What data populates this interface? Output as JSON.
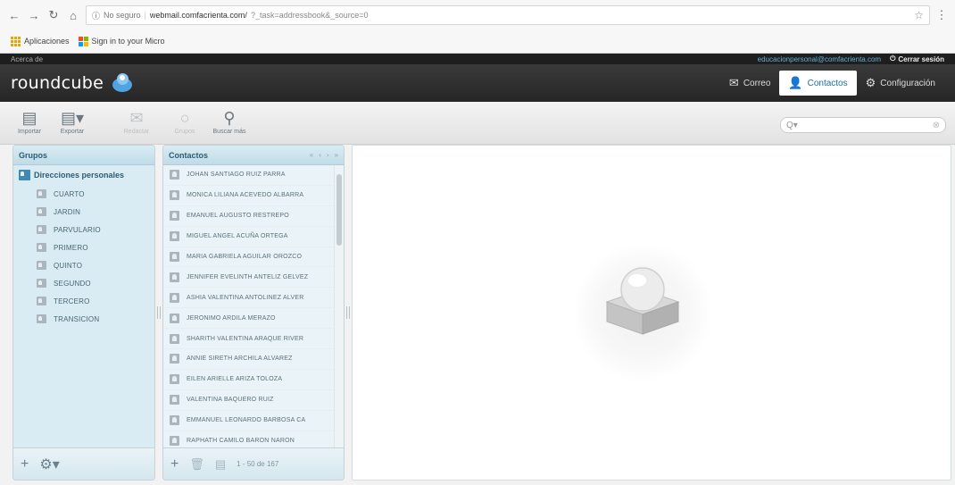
{
  "browser": {
    "secure_label": "No seguro",
    "url_host": "webmail.comfacrienta.com/",
    "url_rest": "?_task=addressbook&_source=0",
    "bookmarks": [
      "Aplicaciones",
      "Sign in to your Micro"
    ]
  },
  "topline": {
    "left": "Acerca de",
    "user": "educacionpersonal@comfacrienta.com",
    "logout": "Cerrar sesión"
  },
  "header": {
    "logo": "roundcube",
    "tasks": [
      {
        "label": "Correo",
        "icon": "mail-icon"
      },
      {
        "label": "Contactos",
        "icon": "contacts-icon"
      },
      {
        "label": "Configuración",
        "icon": "gear-icon"
      }
    ]
  },
  "toolbar": {
    "buttons": [
      {
        "label": "Importar",
        "icon": "import-icon",
        "enabled": true
      },
      {
        "label": "Exportar",
        "icon": "export-icon",
        "enabled": true
      },
      {
        "label": "Redactar",
        "icon": "compose-icon",
        "enabled": false
      },
      {
        "label": "Grupos",
        "icon": "groups-icon",
        "enabled": false
      },
      {
        "label": "Buscar más",
        "icon": "search-icon",
        "enabled": true
      }
    ],
    "search_placeholder": "Q▾"
  },
  "groups": {
    "title": "Grupos",
    "root": "Direcciones personales",
    "items": [
      "CUARTO",
      "JARDIN",
      "PARVULARIO",
      "PRIMERO",
      "QUINTO",
      "SEGUNDO",
      "TERCERO",
      "TRANSICION"
    ]
  },
  "contacts": {
    "title": "Contactos",
    "pager": [
      "«",
      "‹",
      "›",
      "»"
    ],
    "count": "1 - 50 de 167",
    "rows": [
      "JOHAN SANTIAGO RUIZ PARRA",
      "MONICA LILIANA ACEVEDO ALBARRA",
      "EMANUEL AUGUSTO RESTREPO",
      "MIGUEL ANGEL ACUÑA ORTEGA",
      "MARIA GABRIELA AGUILAR OROZCO",
      "JENNIFER EVELINTH ANTELIZ GELVEZ",
      "ASHIA VALENTINA ANTOLINEZ ALVER",
      "JERONIMO ARDILA MERAZO",
      "SHARITH VALENTINA ARAQUE RIVER",
      "ANNIE SIRETH ARCHILA ALVAREZ",
      "EILEN ARIELLE ARIZA TOLOZA",
      "VALENTINA BAQUERO RUIZ",
      "EMMANUEL LEONARDO BARBOSA CA",
      "RAPHATH CAMILO BARON NARON"
    ]
  }
}
